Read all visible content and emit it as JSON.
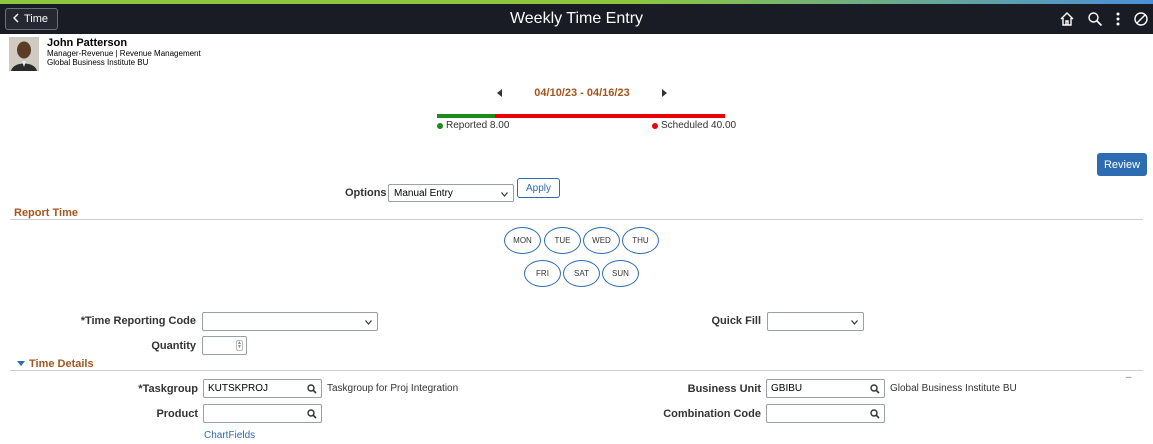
{
  "header": {
    "back_label": "Time",
    "title": "Weekly Time Entry",
    "icons": [
      "home-icon",
      "search-icon",
      "more-icon",
      "navbar-icon"
    ]
  },
  "employee": {
    "name": "John Patterson",
    "title_line": "Manager-Revenue | Revenue Management",
    "bu_line": "Global Business Institute BU"
  },
  "period": {
    "date_range": "04/10/23 - 04/16/23",
    "reported_label": "Reported 8.00",
    "scheduled_label": "Scheduled 40.00",
    "reported_fraction": 0.2,
    "reported_color": "#1c8a1c",
    "scheduled_color": "#e8000b"
  },
  "actions": {
    "review_label": "Review",
    "apply_label": "Apply"
  },
  "options": {
    "label": "Options",
    "selected": "Manual Entry"
  },
  "report_time": {
    "title": "Report Time",
    "days": [
      "MON",
      "TUE",
      "WED",
      "THU",
      "FRI",
      "SAT",
      "SUN"
    ],
    "trc_label": "*Time Reporting Code",
    "trc_value": "",
    "quick_fill_label": "Quick Fill",
    "quick_fill_value": "",
    "quantity_label": "Quantity",
    "quantity_value": ""
  },
  "time_details": {
    "title": "Time Details",
    "taskgroup_label": "*Taskgroup",
    "taskgroup_value": "KUTSKPROJ",
    "taskgroup_desc": "Taskgroup for Proj Integration",
    "business_unit_label": "Business Unit",
    "business_unit_value": "GBIBU",
    "business_unit_desc": "Global Business Institute BU",
    "product_label": "Product",
    "product_value": "",
    "combination_code_label": "Combination Code",
    "combination_code_value": "",
    "chartfields_link": "ChartFields",
    "collapse_marker": "–"
  },
  "colors": {
    "accent": "#2d6cb2",
    "section_title": "#a3561e",
    "banner": "#191c24"
  }
}
